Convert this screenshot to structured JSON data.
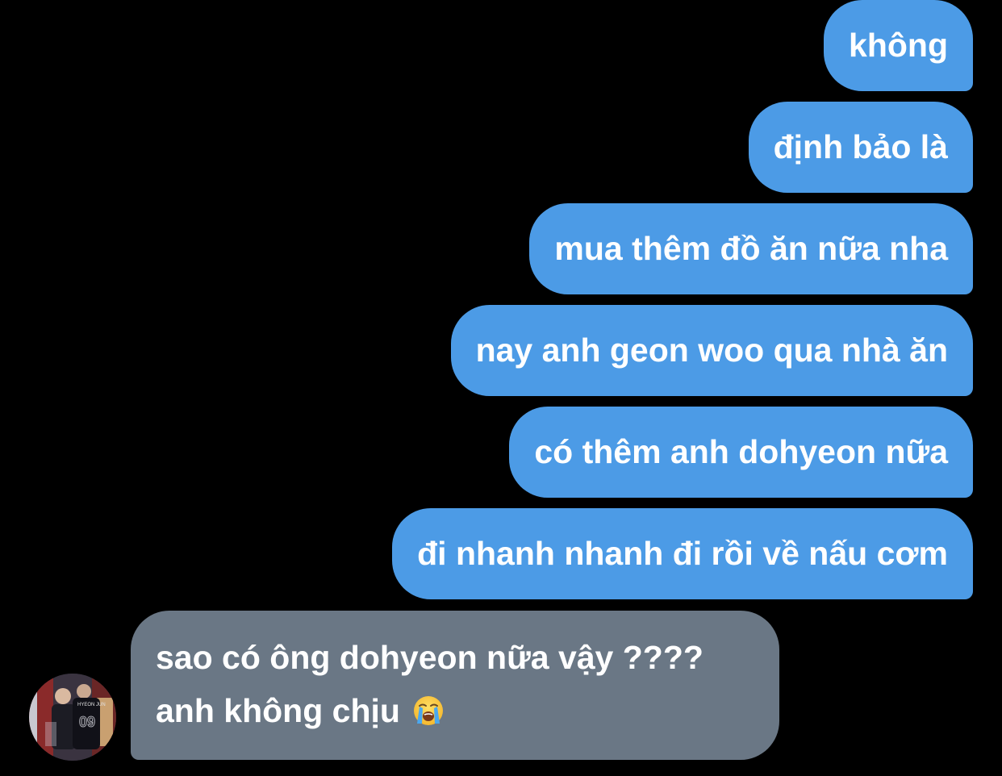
{
  "conversation": {
    "sent": [
      {
        "text": "không"
      },
      {
        "text": "định bảo là"
      },
      {
        "text": "mua thêm đồ ăn nữa nha"
      },
      {
        "text": "nay anh geon woo qua nhà ăn"
      },
      {
        "text": "có thêm anh dohyeon nữa"
      },
      {
        "text": "đi nhanh nhanh đi rồi về nấu cơm"
      }
    ],
    "received": {
      "line1": "sao có ông dohyeon nữa vậy ????",
      "line2": "anh không chịu",
      "emoji": "loudly-crying-face-emoji"
    },
    "avatar": {
      "icon": "contact-avatar-photo"
    }
  },
  "colors": {
    "background": "#000000",
    "sent_bubble": "#4c9be6",
    "received_bubble": "#6a7785",
    "text": "#ffffff"
  }
}
